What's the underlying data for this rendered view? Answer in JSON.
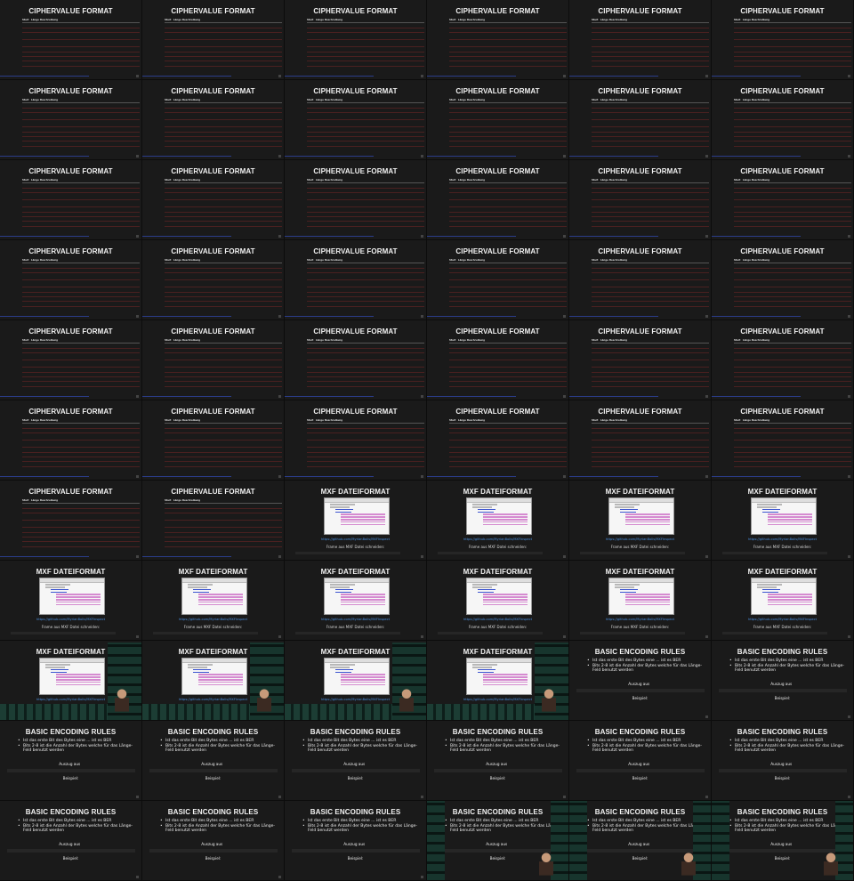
{
  "slides": {
    "cipher": {
      "title": "CIPHERVALUE FORMAT",
      "headers": {
        "start": "Start",
        "laenge": "Länge",
        "beschreibung": "Beschreibung"
      }
    },
    "mxf": {
      "title": "MXF DATEIFORMAT",
      "link": "https://github.com/MyrianBolis/MXFInspect",
      "subtitle": "Frame aus MXF Datei schneiden:"
    },
    "ber": {
      "title": "BASIC ENCODING RULES",
      "bullets": [
        "Ist das erste Bit des Bytes eine ... ist es BER",
        "Bits 2-8 ist die Anzahl der Bytes welche für das Länge-Feld benutzt werden"
      ],
      "auszug_label": "Auszug aus",
      "beispiel": "Beispiel:"
    }
  },
  "tile_sequence": [
    "cipher",
    "cipher",
    "cipher",
    "cipher",
    "cipher",
    "cipher",
    "cipher",
    "cipher",
    "cipher",
    "cipher",
    "cipher",
    "cipher",
    "cipher",
    "cipher",
    "cipher",
    "cipher",
    "cipher",
    "cipher",
    "cipher",
    "cipher",
    "cipher",
    "cipher",
    "cipher",
    "cipher",
    "cipher",
    "cipher",
    "cipher",
    "cipher",
    "cipher",
    "cipher",
    "cipher",
    "cipher",
    "cipher",
    "cipher",
    "cipher",
    "cipher",
    "cipher",
    "cipher",
    "mxf",
    "mxf",
    "mxf",
    "mxf",
    "mxf",
    "mxf",
    "mxf",
    "mxf",
    "mxf",
    "mxf",
    "mxf-video",
    "mxf-video",
    "mxf-video",
    "mxf-video",
    "ber",
    "ber",
    "ber",
    "ber",
    "ber",
    "ber",
    "ber",
    "ber",
    "ber",
    "ber",
    "ber",
    "ber-video",
    "ber-video",
    "ber-video"
  ],
  "colors": {
    "background": "#1a1a1a",
    "accent_red": "#e05050",
    "link_blue": "#4a90e2",
    "video_green": "#1c3d34"
  }
}
